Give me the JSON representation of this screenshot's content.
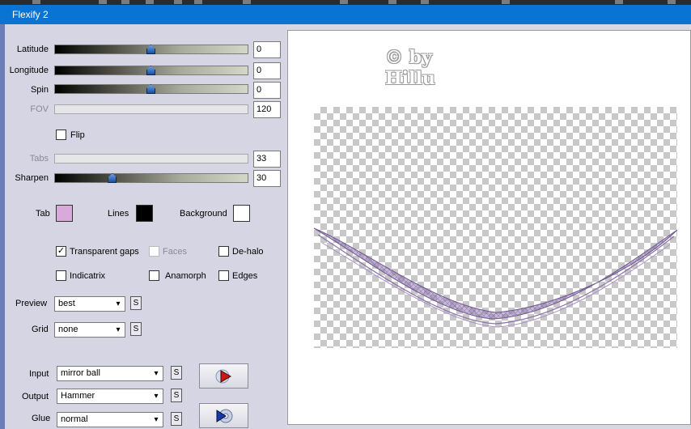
{
  "window": {
    "title": "Flexify 2"
  },
  "sliders": [
    {
      "label": "Latitude",
      "value": "0",
      "position": 0.5,
      "enabled": true
    },
    {
      "label": "Longitude",
      "value": "0",
      "position": 0.5,
      "enabled": true
    },
    {
      "label": "Spin",
      "value": "0",
      "position": 0.5,
      "enabled": true
    },
    {
      "label": "FOV",
      "value": "120",
      "enabled": false
    },
    {
      "label": "Tabs",
      "value": "33",
      "enabled": false
    },
    {
      "label": "Sharpen",
      "value": "30",
      "position": 0.3,
      "enabled": true
    }
  ],
  "flip": {
    "label": "Flip",
    "checked": false
  },
  "colors": {
    "tab_label": "Tab",
    "tab_color": "#d9a9dc",
    "lines_label": "Lines",
    "lines_color": "#000000",
    "background_label": "Background",
    "background_color": "#ffffff"
  },
  "checkboxes": {
    "transparent_gaps": {
      "label": "Transparent gaps",
      "checked": true
    },
    "faces": {
      "label": "Faces",
      "checked": false,
      "enabled": false
    },
    "de_halo": {
      "label": "De-halo",
      "checked": false
    },
    "indicatrix": {
      "label": "Indicatrix",
      "checked": false
    },
    "anamorph": {
      "label": "Anamorph",
      "checked": false
    },
    "edges": {
      "label": "Edges",
      "checked": false
    }
  },
  "preview": {
    "label": "Preview",
    "value": "best"
  },
  "grid": {
    "label": "Grid",
    "value": "none"
  },
  "input": {
    "label": "Input",
    "value": "mirror ball"
  },
  "output": {
    "label": "Output",
    "value": "Hammer"
  },
  "glue": {
    "label": "Glue",
    "value": "normal"
  },
  "s_label": "S",
  "check_mark": "✓",
  "combo_arrow": "▾",
  "icons": {
    "input_button": "red-play-arrow-icon",
    "output_button": "blue-play-disc-icon"
  },
  "watermark": {
    "line1": "© by",
    "line2": "Hillu"
  },
  "accent_color": "#0a74d4",
  "shape_color": "#9a82b8"
}
